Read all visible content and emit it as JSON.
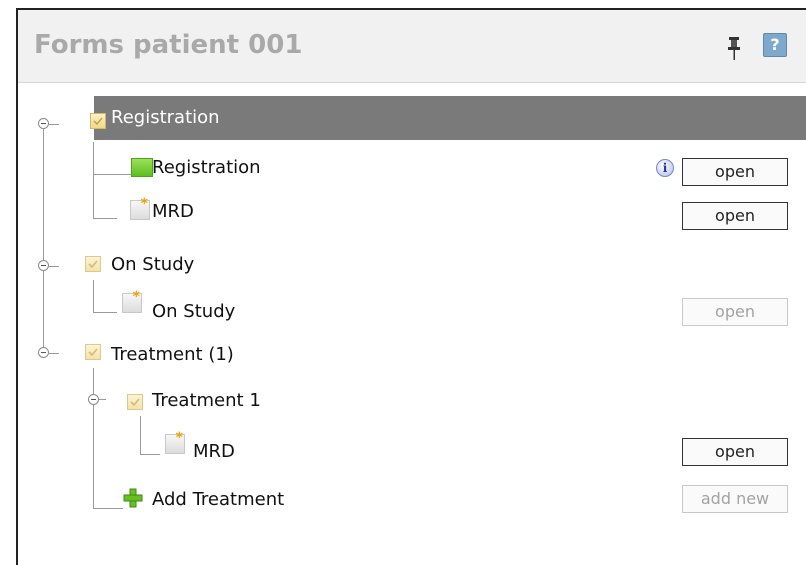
{
  "panel": {
    "title": "Forms patient 001",
    "pin_icon": "pin-icon",
    "help_label": "?"
  },
  "tree": {
    "registration_group": "Registration",
    "registration_form": "Registration",
    "registration_info": "i",
    "registration_mrd": "MRD",
    "on_study_group": "On Study",
    "on_study_form": "On Study",
    "treatment_group": "Treatment (1)",
    "treatment_1": "Treatment 1",
    "treatment_mrd": "MRD",
    "add_treatment": "Add Treatment"
  },
  "buttons": {
    "open": "open",
    "add_new": "add new"
  },
  "colors": {
    "selected_row": "#7a7a7a",
    "header_bg": "#f1f1f1",
    "title_text": "#a9a9a9",
    "help_bg": "#7fa9cc"
  }
}
